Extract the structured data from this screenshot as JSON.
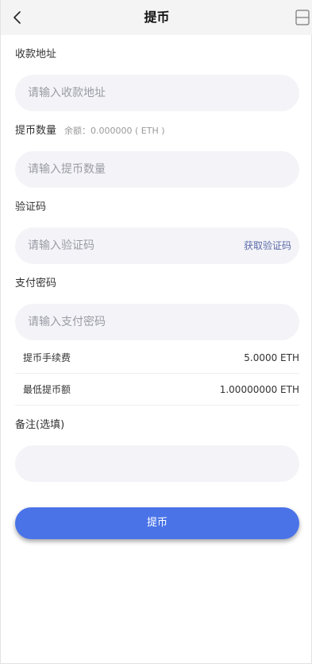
{
  "header": {
    "title": "提币",
    "back_icon": "chevron-left-icon",
    "menu_icon": "menu-icon"
  },
  "form": {
    "address": {
      "label": "收款地址",
      "placeholder": "请输入收款地址",
      "value": ""
    },
    "amount": {
      "label": "提币数量",
      "balance_text": "余额：0.000000 ( ETH )",
      "placeholder": "请输入提币数量",
      "value": ""
    },
    "verification": {
      "label": "验证码",
      "placeholder": "请输入验证码",
      "value": "",
      "get_code_label": "获取验证码"
    },
    "pay_password": {
      "label": "支付密码",
      "placeholder": "请输入支付密码",
      "value": ""
    },
    "fee": {
      "label": "提币手续费",
      "value": "5.0000 ETH"
    },
    "min_withdraw": {
      "label": "最低提币额",
      "value": "1.00000000 ETH"
    },
    "remark": {
      "label": "备注(选填)",
      "placeholder": "",
      "value": ""
    }
  },
  "submit": {
    "label": "提币"
  },
  "colors": {
    "primary": "#4a73e8",
    "link": "#5b6aa8",
    "input_bg": "#f4f4f8",
    "header_bg": "#f4f4f4"
  }
}
